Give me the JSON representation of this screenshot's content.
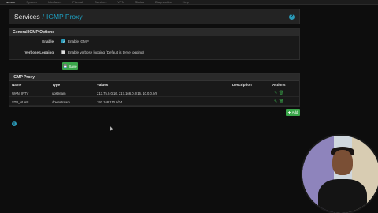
{
  "topbar": {
    "logo": "sense",
    "items": [
      "System",
      "Interfaces",
      "Firewall",
      "Services",
      "VPN",
      "Status",
      "Diagnostics",
      "Help"
    ]
  },
  "header": {
    "crumb_root": "Services",
    "crumb_sep": "/",
    "crumb_page": "IGMP Proxy",
    "help_glyph": "?"
  },
  "general": {
    "title": "General IGMP Options",
    "enable": {
      "label": "Enable",
      "checkbox_text": "Enable IGMP",
      "checked": true
    },
    "verbose": {
      "label": "Verbose Logging",
      "checkbox_text": "Enable verbose logging (Default is terse logging)",
      "checked": false
    },
    "save_label": "Save"
  },
  "proxy": {
    "title": "IGMP Proxy",
    "columns": {
      "name": "Name",
      "type": "Type",
      "values": "Values",
      "description": "Description",
      "actions": "Actions"
    },
    "rows": [
      {
        "name": "WAN_IPTV",
        "type": "upstream",
        "values": "213.75.0.0/16, 217.166.0.0/16, 10.0.0.0/8",
        "description": ""
      },
      {
        "name": "STB_VLAN",
        "type": "downstream",
        "values": "192.168.110.0/24",
        "description": ""
      }
    ],
    "add_label": "Add"
  },
  "info_glyph": "i",
  "colors": {
    "accent": "#1e9fc0",
    "success": "#3aa64a",
    "background": "#0d0d0d"
  },
  "icons": [
    "help-icon",
    "check-icon",
    "save-icon",
    "edit-icon",
    "trash-icon",
    "plus-icon",
    "info-icon"
  ]
}
